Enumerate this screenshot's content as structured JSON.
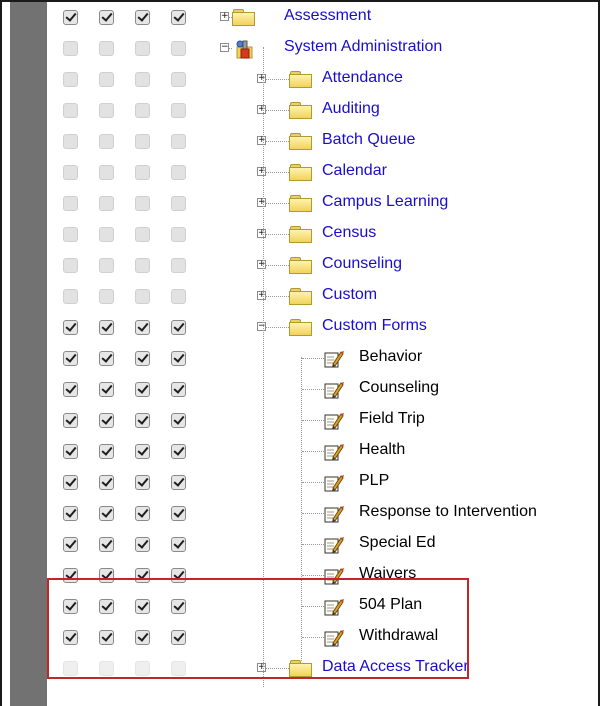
{
  "tree": {
    "rows": [
      {
        "label": "Assessment",
        "level": 0,
        "expander": "+",
        "icon": "folder-icon",
        "checked": true,
        "link": true
      },
      {
        "label": "System Administration",
        "level": 0,
        "expander": "-",
        "icon": "tools-icon",
        "checked": false,
        "link": true
      },
      {
        "label": "Attendance",
        "level": 1,
        "expander": "+",
        "icon": "folder-icon",
        "checked": false,
        "link": true
      },
      {
        "label": "Auditing",
        "level": 1,
        "expander": "+",
        "icon": "folder-icon",
        "checked": false,
        "link": true
      },
      {
        "label": "Batch Queue",
        "level": 1,
        "expander": "+",
        "icon": "folder-icon",
        "checked": false,
        "link": true
      },
      {
        "label": "Calendar",
        "level": 1,
        "expander": "+",
        "icon": "folder-icon",
        "checked": false,
        "link": true
      },
      {
        "label": "Campus Learning",
        "level": 1,
        "expander": "+",
        "icon": "folder-icon",
        "checked": false,
        "link": true
      },
      {
        "label": "Census",
        "level": 1,
        "expander": "+",
        "icon": "folder-icon",
        "checked": false,
        "link": true
      },
      {
        "label": "Counseling",
        "level": 1,
        "expander": "+",
        "icon": "folder-icon",
        "checked": false,
        "link": true
      },
      {
        "label": "Custom",
        "level": 1,
        "expander": "+",
        "icon": "folder-icon",
        "checked": false,
        "link": true
      },
      {
        "label": "Custom Forms",
        "level": 1,
        "expander": "-",
        "icon": "folder-icon",
        "checked": true,
        "link": true
      },
      {
        "label": "Behavior",
        "level": 2,
        "expander": "",
        "icon": "form-icon",
        "checked": true,
        "link": false
      },
      {
        "label": "Counseling",
        "level": 2,
        "expander": "",
        "icon": "form-icon",
        "checked": true,
        "link": false
      },
      {
        "label": "Field Trip",
        "level": 2,
        "expander": "",
        "icon": "form-icon",
        "checked": true,
        "link": false
      },
      {
        "label": "Health",
        "level": 2,
        "expander": "",
        "icon": "form-icon",
        "checked": true,
        "link": false
      },
      {
        "label": "PLP",
        "level": 2,
        "expander": "",
        "icon": "form-icon",
        "checked": true,
        "link": false
      },
      {
        "label": "Response to Intervention",
        "level": 2,
        "expander": "",
        "icon": "form-icon",
        "checked": true,
        "link": false
      },
      {
        "label": "Special Ed",
        "level": 2,
        "expander": "",
        "icon": "form-icon",
        "checked": true,
        "link": false
      },
      {
        "label": "Waivers",
        "level": 2,
        "expander": "",
        "icon": "form-icon",
        "checked": true,
        "link": false
      },
      {
        "label": "504 Plan",
        "level": 2,
        "expander": "",
        "icon": "form-icon",
        "checked": true,
        "link": false
      },
      {
        "label": "Withdrawal",
        "level": 2,
        "expander": "",
        "icon": "form-icon",
        "checked": true,
        "link": false
      },
      {
        "label": "Data Access Tracker",
        "level": 1,
        "expander": "+",
        "icon": "folder-icon",
        "checked": false,
        "link": true
      }
    ]
  },
  "colors": {
    "link": "#1a0dcc",
    "highlight": "#c0262c",
    "gutter": "#727272"
  }
}
